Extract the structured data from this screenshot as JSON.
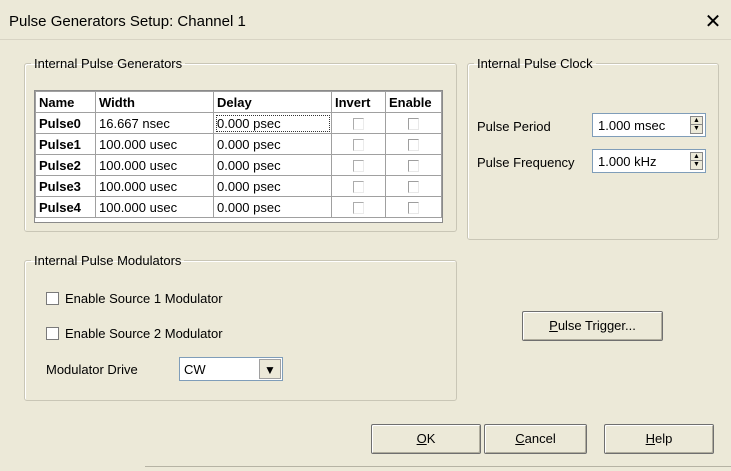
{
  "window": {
    "title": "Pulse Generators Setup: Channel 1",
    "close_glyph": "✕"
  },
  "pulse_generators": {
    "group_label": "Internal Pulse Generators",
    "columns": [
      "Name",
      "Width",
      "Delay",
      "Invert",
      "Enable"
    ],
    "rows": [
      {
        "name": "Pulse0",
        "width": "16.667 nsec",
        "delay": "0.000 psec",
        "invert": false,
        "enable": false
      },
      {
        "name": "Pulse1",
        "width": "100.000 usec",
        "delay": "0.000 psec",
        "invert": false,
        "enable": false
      },
      {
        "name": "Pulse2",
        "width": "100.000 usec",
        "delay": "0.000 psec",
        "invert": false,
        "enable": false
      },
      {
        "name": "Pulse3",
        "width": "100.000 usec",
        "delay": "0.000 psec",
        "invert": false,
        "enable": false
      },
      {
        "name": "Pulse4",
        "width": "100.000 usec",
        "delay": "0.000 psec",
        "invert": false,
        "enable": false
      }
    ]
  },
  "pulse_clock": {
    "group_label": "Internal Pulse Clock",
    "period_label": "Pulse Period",
    "period_value": "1.000 msec",
    "frequency_label": "Pulse Frequency",
    "frequency_value": "1.000 kHz"
  },
  "modulators": {
    "group_label": "Internal Pulse Modulators",
    "source1_label": "Enable Source 1 Modulator",
    "source1_checked": false,
    "source2_label": "Enable Source 2 Modulator",
    "source2_checked": false,
    "drive_label": "Modulator Drive",
    "drive_value": "CW"
  },
  "buttons": {
    "trigger": {
      "accel": "P",
      "rest": "ulse Trigger..."
    },
    "ok": {
      "accel": "O",
      "rest": "K"
    },
    "cancel": {
      "accel": "C",
      "rest": "ancel"
    },
    "help": {
      "accel": "H",
      "rest": "elp"
    }
  },
  "icons": {
    "spin_up": "▲",
    "spin_down": "▼",
    "dropdown": "▼"
  }
}
